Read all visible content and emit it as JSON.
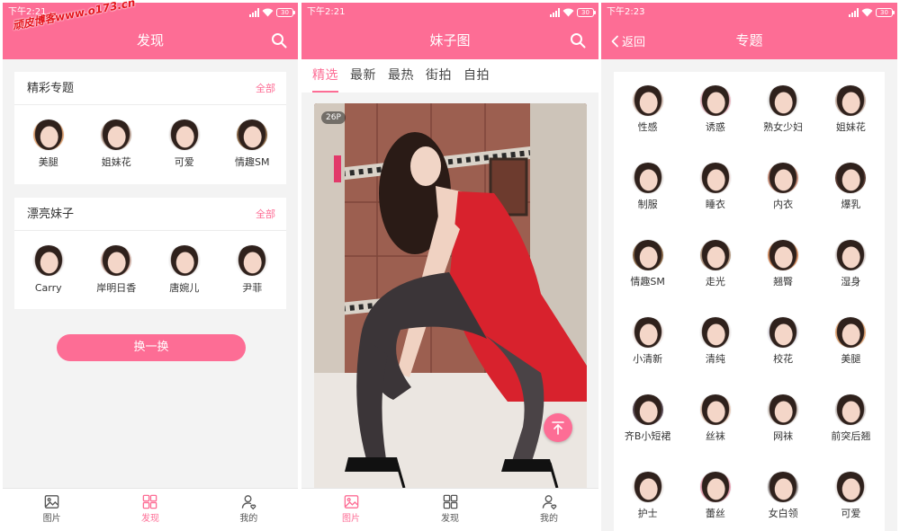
{
  "accent": "#fd6d95",
  "watermark": "顽皮博客www.o173.cn",
  "discover": {
    "status_time": "下午2:21",
    "battery": "30",
    "title": "发现",
    "sections": [
      {
        "title": "精彩专题",
        "more": "全部",
        "items": [
          {
            "label": "美腿",
            "tint": "#e3a777"
          },
          {
            "label": "姐妹花",
            "tint": "#c9b2a6"
          },
          {
            "label": "可爱",
            "tint": "#e9e4e2"
          },
          {
            "label": "情趣SM",
            "tint": "#8c6a48"
          }
        ]
      },
      {
        "title": "漂亮妹子",
        "more": "全部",
        "items": [
          {
            "label": "Carry",
            "tint": "#ece6e6"
          },
          {
            "label": "岸明日香",
            "tint": "#d7b7ad"
          },
          {
            "label": "唐婉儿",
            "tint": "#f1eeee"
          },
          {
            "label": "尹菲",
            "tint": "#f4f2f1"
          }
        ]
      }
    ],
    "shuffle_label": "换一换",
    "nav": [
      {
        "label": "图片",
        "icon": "image-icon"
      },
      {
        "label": "发现",
        "icon": "grid-icon"
      },
      {
        "label": "我的",
        "icon": "profile-icon"
      }
    ],
    "nav_active_index": 1
  },
  "gallery": {
    "status_time": "下午2:21",
    "battery": "30",
    "title": "妹子图",
    "tabs": [
      {
        "label": "精选"
      },
      {
        "label": "最新"
      },
      {
        "label": "最热"
      },
      {
        "label": "街拍"
      },
      {
        "label": "自拍"
      }
    ],
    "active_tab_index": 0,
    "card": {
      "count_badge": "26P"
    },
    "nav": [
      {
        "label": "图片",
        "icon": "image-icon"
      },
      {
        "label": "发现",
        "icon": "grid-icon"
      },
      {
        "label": "我的",
        "icon": "profile-icon"
      }
    ],
    "nav_active_index": 0
  },
  "topics": {
    "status_time": "下午2:23",
    "battery": "30",
    "back_label": "返回",
    "title": "专题",
    "items": [
      {
        "label": "性感",
        "tint": "#d9c3b8"
      },
      {
        "label": "诱惑",
        "tint": "#e9b9c4"
      },
      {
        "label": "熟女少妇",
        "tint": "#ececec"
      },
      {
        "label": "姐妹花",
        "tint": "#c9b2a6"
      },
      {
        "label": "制服",
        "tint": "#e8e3e0"
      },
      {
        "label": "睡衣",
        "tint": "#f0e2e0"
      },
      {
        "label": "内衣",
        "tint": "#c98f7a"
      },
      {
        "label": "爆乳",
        "tint": "#5a3c33"
      },
      {
        "label": "情趣SM",
        "tint": "#8c6a48"
      },
      {
        "label": "走光",
        "tint": "#b59b86"
      },
      {
        "label": "翘臀",
        "tint": "#d48b5e"
      },
      {
        "label": "湿身",
        "tint": "#dcd4d2"
      },
      {
        "label": "小清新",
        "tint": "#f3e6e2"
      },
      {
        "label": "清纯",
        "tint": "#efebea"
      },
      {
        "label": "校花",
        "tint": "#e6e4ec"
      },
      {
        "label": "美腿",
        "tint": "#e3a777"
      },
      {
        "label": "齐B小短裙",
        "tint": "#5b4c57"
      },
      {
        "label": "丝袜",
        "tint": "#e7cbbb"
      },
      {
        "label": "网袜",
        "tint": "#d8cec8"
      },
      {
        "label": "前突后翘",
        "tint": "#cfc8c6"
      },
      {
        "label": "护士",
        "tint": "#f1ebe8"
      },
      {
        "label": "蕾丝",
        "tint": "#e6a2b4"
      },
      {
        "label": "女白领",
        "tint": "#a9a3a3"
      },
      {
        "label": "可爱",
        "tint": "#f0ebe9"
      }
    ]
  }
}
